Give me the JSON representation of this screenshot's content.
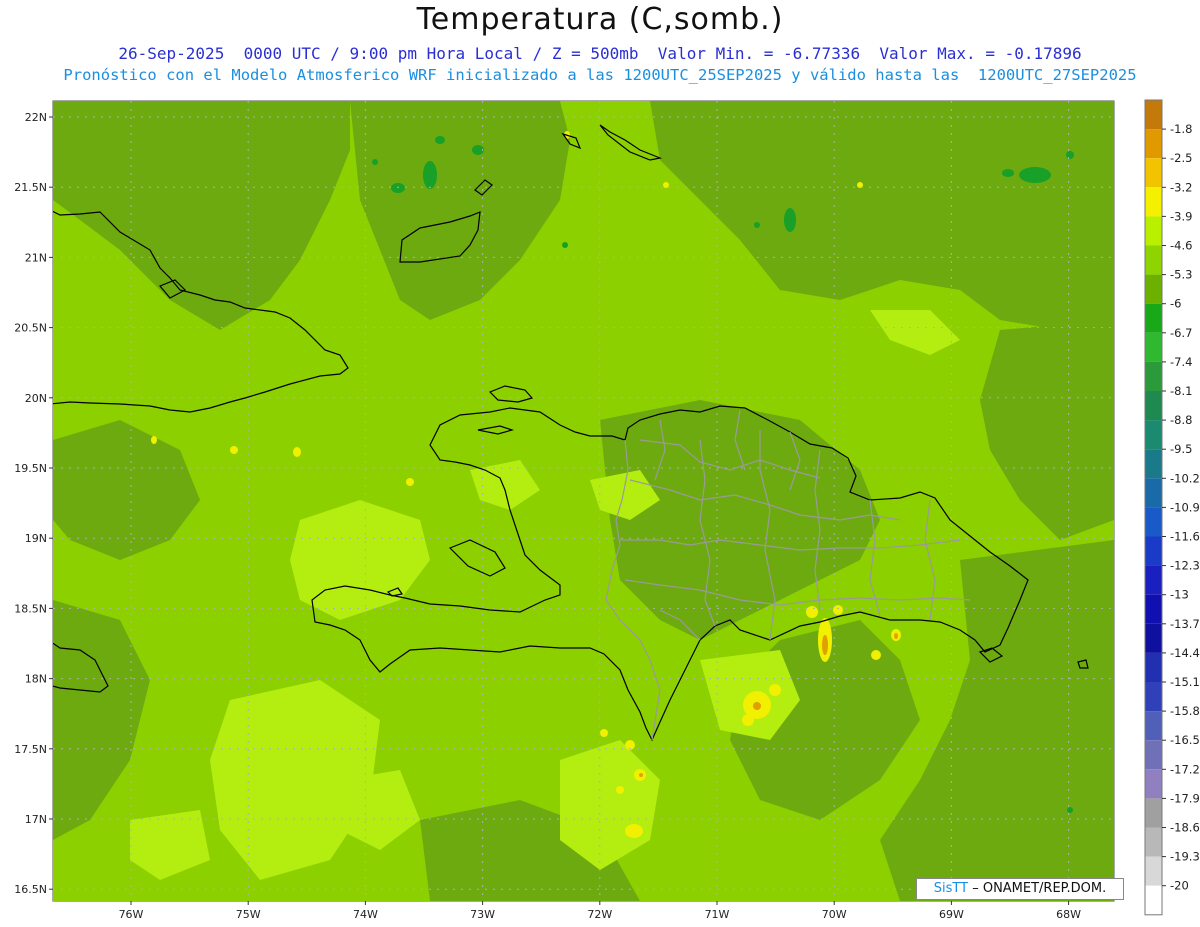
{
  "title": "Temperatura (C,somb.)",
  "subtitle_line1": "26-Sep-2025  0000 UTC / 9:00 pm Hora Local / Z = 500mb  Valor Min. = -6.77336  Valor Max. = -0.17896",
  "subtitle_line2": "Pronóstico con el Modelo Atmosferico WRF inicializado a las 1200UTC_25SEP2025 y válido hasta las  1200UTC_27SEP2025",
  "credit_sis": "SisTT",
  "credit_rest": "– ONAMET/REP.DOM.",
  "lat_labels": [
    "22N",
    "21.5N",
    "21N",
    "20.5N",
    "20N",
    "19.5N",
    "19N",
    "18.5N",
    "18N",
    "17.5N",
    "17N",
    "16.5N"
  ],
  "lon_labels": [
    "76W",
    "75W",
    "74W",
    "73W",
    "72W",
    "71W",
    "70W",
    "69W",
    "68W"
  ],
  "colorbar": {
    "labels": [
      "-1.8",
      "-2.5",
      "-3.2",
      "-3.9",
      "-4.6",
      "-5.3",
      "-6",
      "-6.7",
      "-7.4",
      "-8.1",
      "-8.8",
      "-9.5",
      "-10.2",
      "-10.9",
      "-11.6",
      "-12.3",
      "-13",
      "-13.7",
      "-14.4",
      "-15.1",
      "-15.8",
      "-16.5",
      "-17.2",
      "-17.9",
      "-18.6",
      "-19.3",
      "-20"
    ],
    "colors": [
      "#c47a0a",
      "#e09a00",
      "#f2c400",
      "#f5f000",
      "#b8f000",
      "#8fd400",
      "#6cb000",
      "#18a818",
      "#30b830",
      "#2a9a3a",
      "#1f8a50",
      "#1b8a6e",
      "#1a7a8a",
      "#1a6aa8",
      "#1a5ac8",
      "#1a3ac8",
      "#1a20c0",
      "#1010b0",
      "#1010a0",
      "#2030b0",
      "#3040b8",
      "#5060b8",
      "#7070b8",
      "#9080c0",
      "#a0a0a0",
      "#b8b8b8",
      "#d8d8d8",
      "#ffffff"
    ]
  },
  "map_colors": {
    "base": "#8cd000",
    "dark": "#6caa10",
    "light": "#b4ee10",
    "yellow": "#f0f000",
    "orange": "#e0a000",
    "green_cell": "#18a028",
    "coast": "#000000",
    "border": "#9a9a9a",
    "grid": "#b0b0b0"
  }
}
